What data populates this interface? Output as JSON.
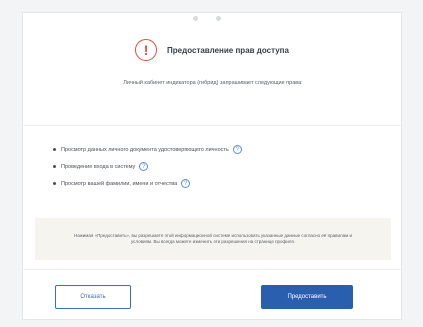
{
  "header": {
    "title": "Предоставление прав доступа",
    "alert_glyph": "!"
  },
  "subtitle": "Личный кабинет индикатора (гибрид) запрашивает следующие права:",
  "permissions": [
    {
      "label": "Просмотр данных личного документа удостоверяющего личность",
      "help_glyph": "?"
    },
    {
      "label": "Проведение входа в систему",
      "help_glyph": "?"
    },
    {
      "label": "Просмотр вашей фамилии, имени и отчества",
      "help_glyph": "?"
    }
  ],
  "notice": "Нажимая «Предоставить», вы разрешаете этой информационной системе использовать указанные данные согласно её правилам и условиям. Вы всегда можете изменить эти разрешения на странице профиля.",
  "buttons": {
    "reject_label": "Отказать",
    "grant_label": "Предоставить"
  },
  "colors": {
    "accent": "#2a5fb0",
    "alert": "#e84a3c",
    "help": "#5b8fd6"
  }
}
